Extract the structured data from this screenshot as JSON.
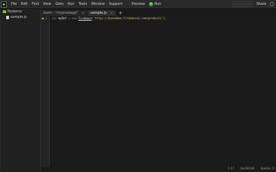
{
  "menubar": {
    "items": [
      "File",
      "Edit",
      "Find",
      "View",
      "Goto",
      "Run",
      "Tools",
      "Window",
      "Support"
    ],
    "preview": "Preview",
    "run": "Run",
    "share": "Share"
  },
  "sidebar": {
    "project": "Nodemo",
    "files": [
      "sample.js"
    ]
  },
  "tabs": [
    {
      "label": "bash - \"myprodapp\"",
      "active": false
    },
    {
      "label": "sample.js",
      "active": true
    }
  ],
  "editor": {
    "line_number": "1",
    "code": {
      "kw": "var ",
      "var": "myRef",
      "op1": " = ",
      "kw2": "new ",
      "cls": "Firebase",
      "op2": "(",
      "str": "'https://basedemo.firebaseio.com/products'",
      "op3": ");"
    }
  },
  "status": {
    "position": "1:17",
    "language": "JavaScript",
    "indent": "Spaces: 4"
  }
}
